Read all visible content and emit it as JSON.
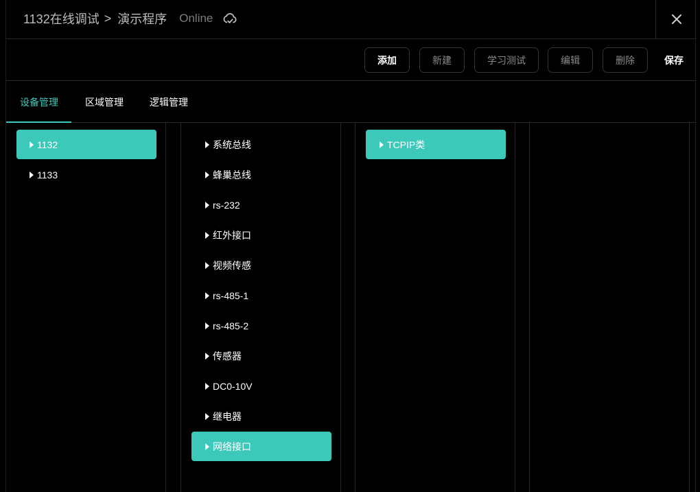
{
  "header": {
    "breadcrumb_root": "1132在线调试",
    "breadcrumb_sep": ">",
    "breadcrumb_current": "演示程序",
    "status": "Online"
  },
  "toolbar": {
    "buttons": [
      {
        "label": "添加",
        "active": true
      },
      {
        "label": "新建",
        "active": false
      },
      {
        "label": "学习测试",
        "active": false
      },
      {
        "label": "编辑",
        "active": false
      },
      {
        "label": "删除",
        "active": false
      }
    ],
    "save_label": "保存"
  },
  "tabs": [
    {
      "label": "设备管理",
      "active": true
    },
    {
      "label": "区域管理",
      "active": false
    },
    {
      "label": "逻辑管理",
      "active": false
    }
  ],
  "columns": {
    "devices": [
      {
        "label": "1132",
        "selected": true
      },
      {
        "label": "1133",
        "selected": false
      }
    ],
    "interfaces": [
      {
        "label": "系统总线",
        "selected": false
      },
      {
        "label": "蜂巢总线",
        "selected": false
      },
      {
        "label": "rs-232",
        "selected": false
      },
      {
        "label": "红外接口",
        "selected": false
      },
      {
        "label": "视频传感",
        "selected": false
      },
      {
        "label": "rs-485-1",
        "selected": false
      },
      {
        "label": "rs-485-2",
        "selected": false
      },
      {
        "label": "传感器",
        "selected": false
      },
      {
        "label": "DC0-10V",
        "selected": false
      },
      {
        "label": "继电器",
        "selected": false
      },
      {
        "label": "网络接口",
        "selected": true
      }
    ],
    "types": [
      {
        "label": "TCPIP类",
        "selected": true
      }
    ]
  },
  "colors": {
    "accent": "#3cc9b9",
    "background": "#000000",
    "border": "#262626"
  },
  "icons": {
    "status": "cloud-check-icon",
    "close": "close-icon",
    "expand": "caret-right-icon"
  }
}
